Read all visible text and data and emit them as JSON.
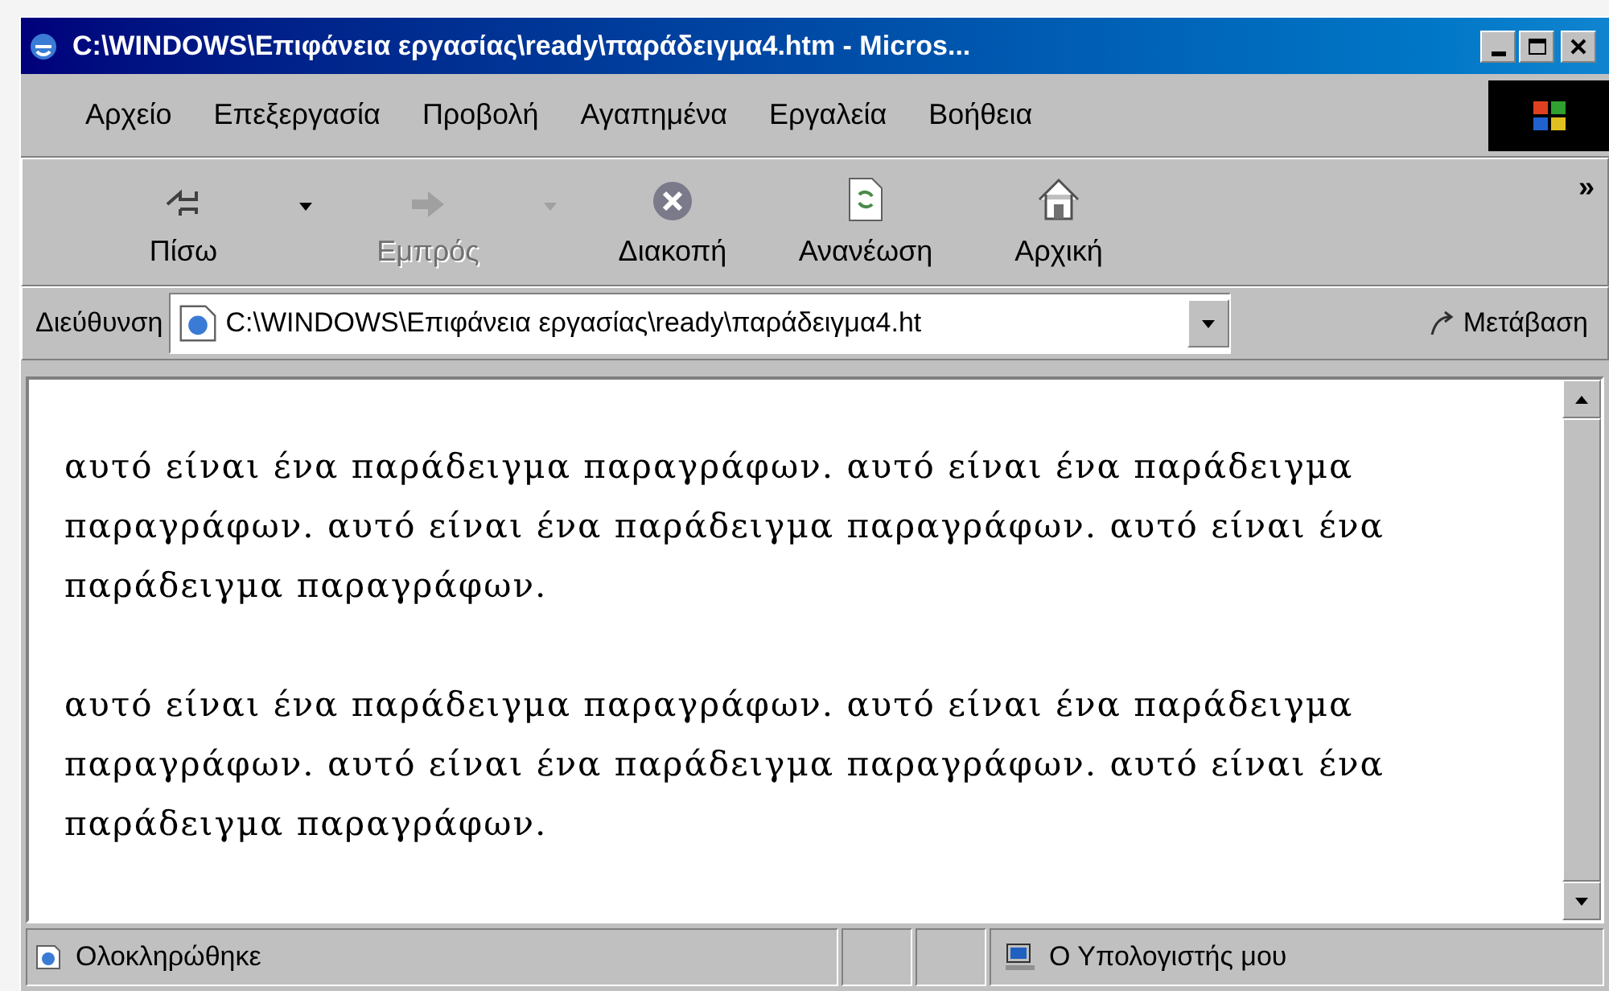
{
  "window": {
    "title": "C:\\WINDOWS\\Επιφάνεια εργασίας\\ready\\παράδειγμα4.htm - Micros..."
  },
  "menu": [
    "Αρχείο",
    "Επεξεργασία",
    "Προβολή",
    "Αγαπημένα",
    "Εργαλεία",
    "Βοήθεια"
  ],
  "toolbar": [
    {
      "label": "Πίσω",
      "kind": "back",
      "disabled": false,
      "dropdown": true
    },
    {
      "label": "Εμπρός",
      "kind": "forward",
      "disabled": true,
      "dropdown": true
    },
    {
      "label": "Διακοπή",
      "kind": "stop",
      "disabled": false,
      "dropdown": false
    },
    {
      "label": "Ανανέωση",
      "kind": "refresh",
      "disabled": false,
      "dropdown": false
    },
    {
      "label": "Αρχική",
      "kind": "home",
      "disabled": false,
      "dropdown": false
    }
  ],
  "toolbar_more": "»",
  "address": {
    "label": "Διεύθυνση",
    "value": "C:\\WINDOWS\\Επιφάνεια εργασίας\\ready\\παράδειγμα4.ht",
    "go": "Μετάβαση"
  },
  "content": {
    "paragraphs": [
      "αυτό είναι ένα παράδειγμα παραγράφων. αυτό είναι ένα παράδειγμα παραγράφων. αυτό είναι ένα παράδειγμα παραγράφων. αυτό είναι ένα παράδειγμα παραγράφων.",
      "αυτό είναι ένα παράδειγμα παραγράφων. αυτό είναι ένα παράδειγμα παραγράφων. αυτό είναι ένα παράδειγμα παραγράφων. αυτό είναι ένα παράδειγμα παραγράφων."
    ]
  },
  "status_bar": {
    "status": "Ολοκληρώθηκε",
    "zone": "Ο Υπολογιστής μου"
  }
}
